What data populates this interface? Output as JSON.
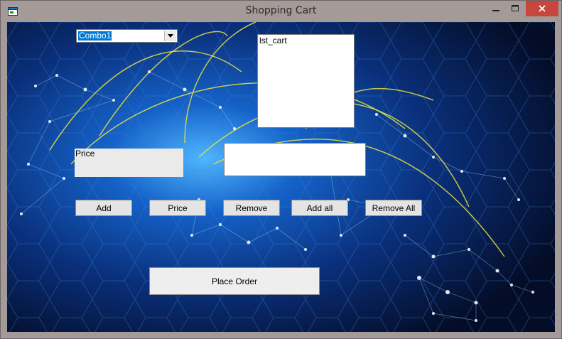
{
  "window": {
    "title": "Shopping Cart"
  },
  "form": {
    "combo_value": "Combo1",
    "list_item": "lst_cart",
    "price_label": "Price",
    "textbox_value": ""
  },
  "buttons": {
    "add": "Add",
    "price": "Price",
    "remove": "Remove",
    "add_all": "Add all",
    "remove_all": "Remove All",
    "place_order": "Place Order"
  },
  "colors": {
    "accent": "#0078d7",
    "close_button": "#c7463d",
    "background": "#06163f"
  }
}
